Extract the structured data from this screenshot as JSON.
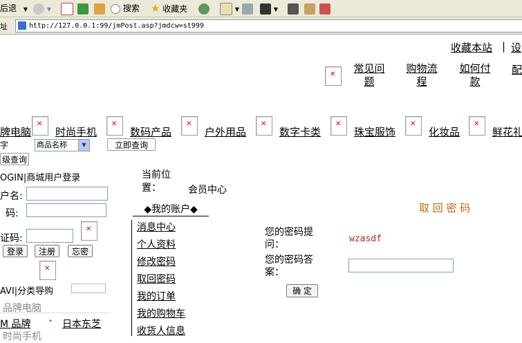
{
  "toolbar": {
    "back_label": "后退",
    "search_label": "搜索",
    "favorites_label": "收藏夹"
  },
  "address": {
    "label": "址",
    "url": "http://127.0.0.1:99/jmPost.asp?jmdcw=st999"
  },
  "topbar": {
    "bookmark": "收藏本站",
    "separator": "|",
    "set": "设"
  },
  "help_links": [
    {
      "label": "常见问题"
    },
    {
      "label": "购物流程"
    },
    {
      "label": "如何付款"
    },
    {
      "label": "配"
    }
  ],
  "categories": [
    {
      "label": "牌电脑"
    },
    {
      "label": "时尚手机"
    },
    {
      "label": "数码产品"
    },
    {
      "label": "户外用品"
    },
    {
      "label": "数字卡类"
    },
    {
      "label": "珠宝服饰"
    },
    {
      "label": "化妆品"
    },
    {
      "label": "鲜花礼"
    }
  ],
  "search": {
    "keyword_fragment": "字",
    "select_value": "商品名称",
    "submit": "立即查询",
    "advanced": "级查询"
  },
  "login": {
    "title": "OGIN|商城用户登录",
    "username_label": "户名:",
    "password_label": "码:",
    "captcha_label": "证码:",
    "login_btn": "登录",
    "register_btn": "注册",
    "forgot_btn": "忘密"
  },
  "nav": {
    "title": "AVI|分类导购",
    "items": [
      "品牌电脑",
      "M 品牌",
      "日本东芝",
      "时尚手机"
    ]
  },
  "breadcrumb": {
    "label": "当前位置：",
    "value": "会员中心"
  },
  "account": {
    "title": "◆我的账户◆",
    "menu": [
      "消息中心",
      "个人资料",
      "修改密码",
      "取回密码",
      "我的订单",
      "我的购物车",
      "收货人信息"
    ]
  },
  "retrieve": {
    "title": "取 回 密 码",
    "hint_label": "您的密码提问：",
    "hint_value": "wzasdf",
    "answer_label": "您的密码答案：",
    "confirm": "确 定"
  },
  "colors": {
    "accent_orange": "#c46a00",
    "hint_red": "#b22222",
    "link": "#000000"
  }
}
